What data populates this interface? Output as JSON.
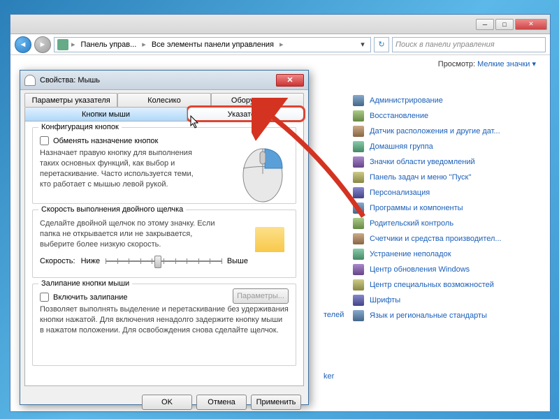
{
  "explorer": {
    "breadcrumb": [
      "Панель управ...",
      "Все элементы панели управления"
    ],
    "search_placeholder": "Поиск в панели управления",
    "view_label": "Просмотр:",
    "view_value": "Мелкие значки ▾",
    "partial_items": [
      "телей",
      "ker"
    ],
    "items": [
      "Администрирование",
      "Восстановление",
      "Датчик расположения и другие дат...",
      "Домашняя группа",
      "Значки области уведомлений",
      "Панель задач и меню ''Пуск''",
      "Персонализация",
      "Программы и компоненты",
      "Родительский контроль",
      "Счетчики и средства производител...",
      "Устранение неполадок",
      "Центр обновления Windows",
      "Центр специальных возможностей",
      "Шрифты",
      "Язык и региональные стандарты"
    ]
  },
  "dialog": {
    "title": "Свойства: Мышь",
    "tabs_row1": [
      "Параметры указателя",
      "Колесико",
      "Оборудование"
    ],
    "tabs_row2": [
      "Кнопки мыши",
      "Указатели"
    ],
    "group1": {
      "title": "Конфигурация кнопок",
      "checkbox": "Обменять назначение кнопок",
      "desc": "Назначает правую кнопку для выполнения таких основных функций, как выбор и перетаскивание. Часто используется теми, кто работает с мышью левой рукой."
    },
    "group2": {
      "title": "Скорость выполнения двойного щелчка",
      "desc": "Сделайте двойной щелчок по этому значку. Если папка не открывается или не закрывается, выберите более низкую скорость.",
      "speed_label": "Скорость:",
      "low": "Ниже",
      "high": "Выше"
    },
    "group3": {
      "title": "Залипание кнопки мыши",
      "checkbox": "Включить залипание",
      "params_btn": "Параметры...",
      "desc": "Позволяет выполнять выделение и перетаскивание без удерживания кнопки нажатой. Для включения ненадолго задержите кнопку мыши в нажатом положении. Для освобождения снова сделайте щелчок."
    },
    "buttons": {
      "ok": "OK",
      "cancel": "Отмена",
      "apply": "Применить"
    }
  }
}
